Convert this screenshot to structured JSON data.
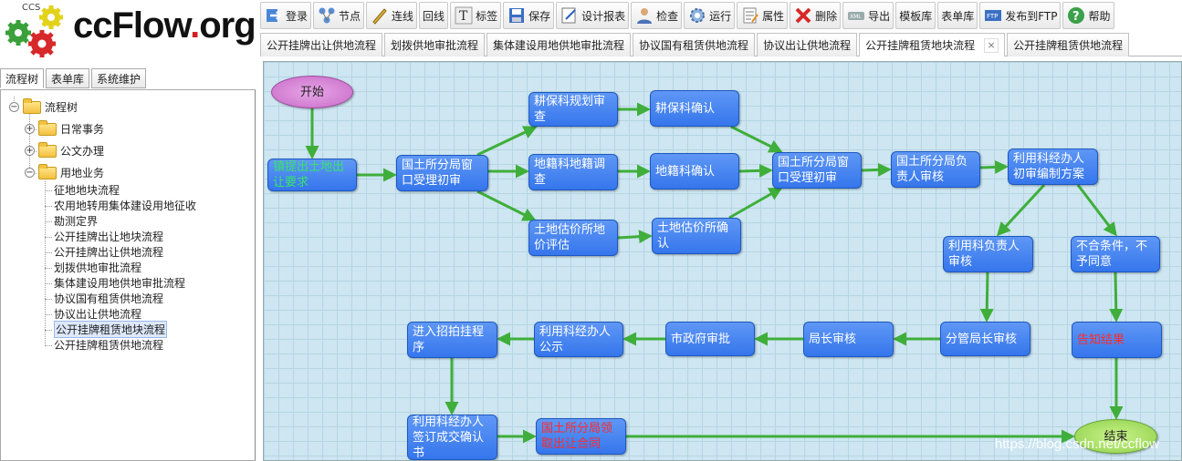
{
  "logo": {
    "small": "CCS",
    "name": "ccFlow",
    "dot": ".",
    "suffix": "org"
  },
  "toolbar": [
    {
      "key": "login",
      "label": "登录",
      "icon": "login-arrow-icon"
    },
    {
      "key": "node",
      "label": "节点",
      "icon": "node-icon"
    },
    {
      "key": "line",
      "label": "连线",
      "icon": "pencil-line-icon"
    },
    {
      "key": "back",
      "label": "回线",
      "icon": ""
    },
    {
      "key": "label",
      "label": "标签",
      "icon": "text-label-icon"
    },
    {
      "key": "save",
      "label": "保存",
      "icon": "save-disk-icon"
    },
    {
      "key": "design",
      "label": "设计报表",
      "icon": "design-report-icon"
    },
    {
      "key": "check",
      "label": "检查",
      "icon": "user-check-icon"
    },
    {
      "key": "run",
      "label": "运行",
      "icon": "gear-run-icon"
    },
    {
      "key": "prop",
      "label": "属性",
      "icon": "properties-icon"
    },
    {
      "key": "delete",
      "label": "删除",
      "icon": "delete-x-icon"
    },
    {
      "key": "export",
      "label": "导出",
      "icon": "export-icon"
    },
    {
      "key": "tmpl",
      "label": "模板库",
      "icon": ""
    },
    {
      "key": "formlib",
      "label": "表单库",
      "icon": ""
    },
    {
      "key": "ftp",
      "label": "发布到FTP",
      "icon": "ftp-icon"
    },
    {
      "key": "help",
      "label": "帮助",
      "icon": "help-question-icon"
    }
  ],
  "doc_tabs": [
    {
      "label": "公开挂牌出让供地流程",
      "active": false
    },
    {
      "label": "划拨供地审批流程",
      "active": false
    },
    {
      "label": "集体建设用地供地审批流程",
      "active": false
    },
    {
      "label": "协议国有租赁供地流程",
      "active": false
    },
    {
      "label": "协议出让供地流程",
      "active": false
    },
    {
      "label": "公开挂牌租赁地块流程",
      "active": true,
      "close": "×"
    },
    {
      "label": "公开挂牌租赁供地流程",
      "active": false
    }
  ],
  "left_tabs": [
    {
      "label": "流程树",
      "active": true
    },
    {
      "label": "表单库",
      "active": false
    },
    {
      "label": "系统维护",
      "active": false
    }
  ],
  "tree": {
    "root": {
      "label": "流程树",
      "toggle": "−"
    },
    "folders": [
      {
        "label": "日常事务",
        "toggle": "+"
      },
      {
        "label": "公文办理",
        "toggle": "+"
      },
      {
        "label": "用地业务",
        "toggle": "−"
      }
    ],
    "leaves": [
      "征地地块流程",
      "农用地转用集体建设用地征收",
      "勘测定界",
      "公开挂牌出让地块流程",
      "公开挂牌出让供地流程",
      "划拨供地审批流程",
      "集体建设用地供地审批流程",
      "协议国有租赁供地流程",
      "协议出让供地流程",
      "公开挂牌租赁地块流程",
      "公开挂牌租赁供地流程"
    ],
    "selected_leaf": "公开挂牌租赁地块流程"
  },
  "colors": {
    "edge": "#3fae3a",
    "node_blue": "#3f7ff0",
    "node_red_text": "#ff2a2a",
    "node_green_text": "#39e36a"
  },
  "flow_nodes": {
    "start": "开始",
    "n1": "镇提出土地出让要求",
    "n2": "国土所分局窗口受理初审",
    "n3": "耕保科规划审查",
    "n4": "耕保科确认",
    "n5": "地籍科地籍调查",
    "n6": "地籍科确认",
    "n7": "土地估价所地价评估",
    "n8": "土地估价所确认",
    "n9": "国土所分局窗口受理初审",
    "n10": "国土所分局负责人审核",
    "n11": "利用科经办人初审编制方案",
    "n12": "利用科负责人审核",
    "n13": "不合条件，不予同意",
    "n14": "分管局长审核",
    "n15": "告知结果",
    "n16": "局长审核",
    "n17": "市政府审批",
    "n18": "利用科经办人公示",
    "n19": "进入招拍挂程序",
    "n20": "利用科经办人签订成交确认书",
    "n21": "国土所分局领取出让合同",
    "end": "结束"
  },
  "watermark": "https://blog.csdn.net/ccflow"
}
